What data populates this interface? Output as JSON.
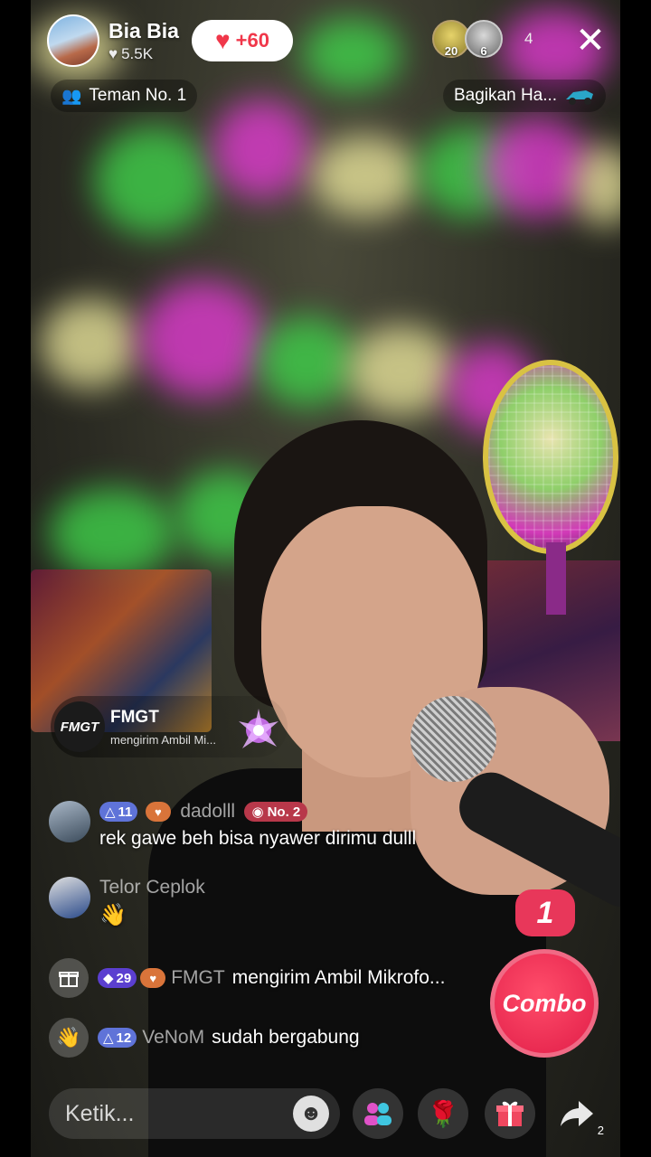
{
  "host": {
    "name": "Bia Bia",
    "likes": "5.5K",
    "follow_label": "+60"
  },
  "viewers": {
    "avatar1_level": "20",
    "avatar2_level": "6",
    "count": "4"
  },
  "close_symbol": "✕",
  "badges": {
    "friend_rank": "Teman No. 1",
    "share_label": "Bagikan Ha..."
  },
  "gift_banner": {
    "logo_text": "FMGT",
    "sender": "FMGT",
    "subtitle": "mengirim Ambil Mi..."
  },
  "chat": [
    {
      "level": "11",
      "user": "dadolll",
      "rank": "No. 2",
      "message": "rek gawe beh bisa nyawer dirimu dulll"
    },
    {
      "user": "Telor Ceplok",
      "message": "👋"
    },
    {
      "level": "29",
      "user": "FMGT",
      "message": "mengirim Ambil Mikrofo..."
    },
    {
      "level": "12",
      "user": "VeNoM",
      "message": "sudah bergabung"
    }
  ],
  "combo": {
    "count": "1",
    "label": "Combo"
  },
  "bottom": {
    "input_placeholder": "Ketik...",
    "share_count": "2"
  },
  "colors": {
    "accent": "#f0374a",
    "combo": "#e11d48",
    "level_badge": "#5f73d8"
  },
  "icons": [
    "heart-icon",
    "people-icon",
    "close-icon",
    "gift-box-icon",
    "wave-icon",
    "emoji-icon",
    "multi-guest-icon",
    "rose-icon",
    "gift-icon",
    "share-icon"
  ]
}
